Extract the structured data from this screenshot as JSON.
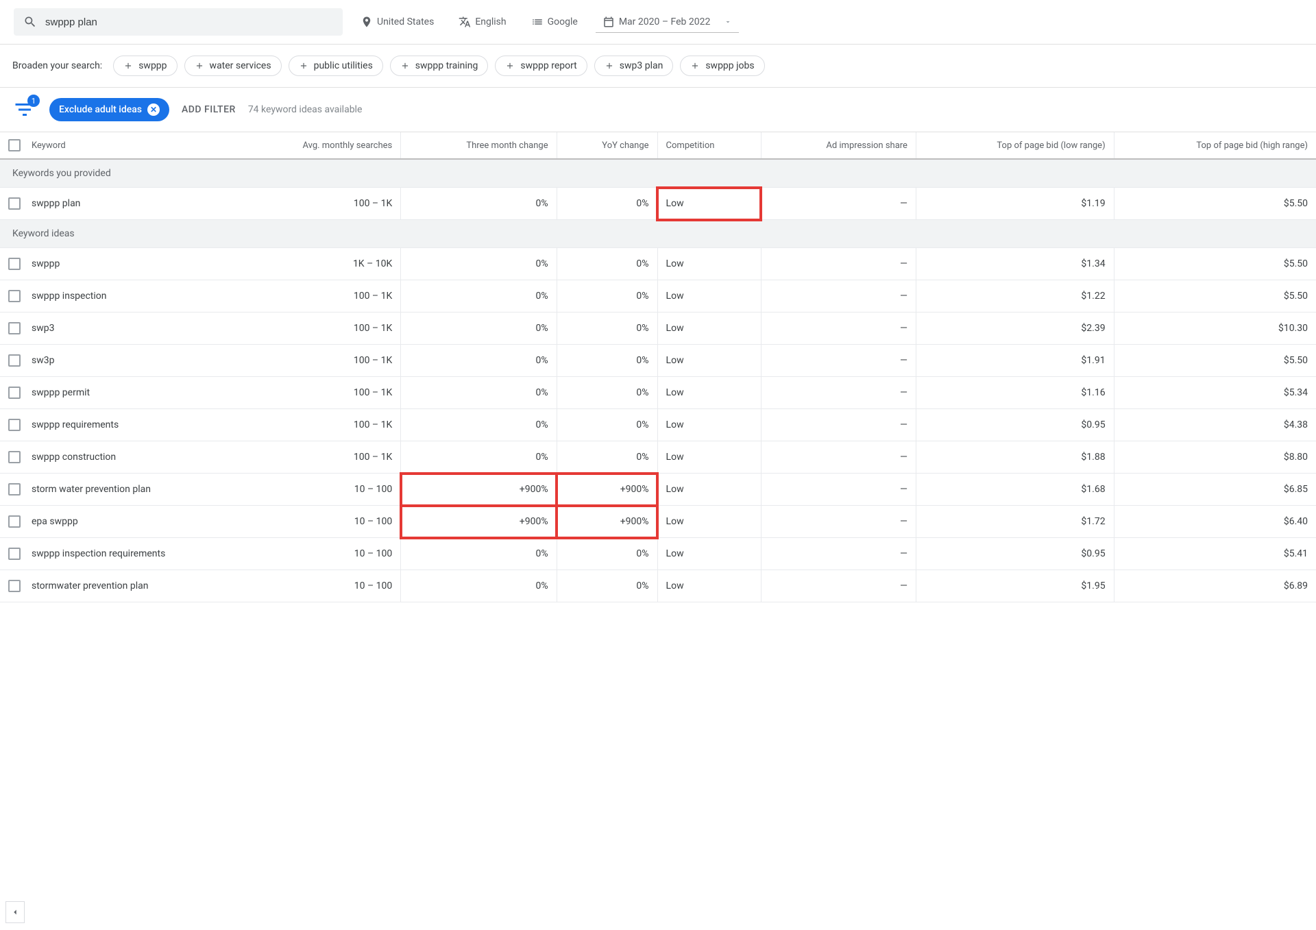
{
  "search": {
    "value": "swppp plan"
  },
  "top_filters": {
    "location": "United States",
    "language": "English",
    "search_network": "Google",
    "date_range": "Mar 2020 – Feb 2022"
  },
  "broaden": {
    "label": "Broaden your search:",
    "chips": [
      "swppp",
      "water services",
      "public utilities",
      "swppp training",
      "swppp report",
      "swp3 plan",
      "swppp jobs"
    ]
  },
  "filters": {
    "funnel_badge": "1",
    "exclude_pill": "Exclude adult ideas",
    "add_filter": "ADD FILTER",
    "count_text": "74 keyword ideas available"
  },
  "columns": {
    "keyword": "Keyword",
    "avg": "Avg. monthly searches",
    "three_month": "Three month change",
    "yoy": "YoY change",
    "competition": "Competition",
    "ad_share": "Ad impression share",
    "bid_low": "Top of page bid (low range)",
    "bid_high": "Top of page bid (high range)"
  },
  "sections": {
    "provided": "Keywords you provided",
    "ideas": "Keyword ideas"
  },
  "rows_provided": [
    {
      "keyword": "swppp plan",
      "avg": "100 – 1K",
      "three_month": "0%",
      "yoy": "0%",
      "competition": "Low",
      "ad_share": "—",
      "bid_low": "$1.19",
      "bid_high": "$5.50",
      "hl_comp": true
    }
  ],
  "rows_ideas": [
    {
      "keyword": "swppp",
      "avg": "1K – 10K",
      "three_month": "0%",
      "yoy": "0%",
      "competition": "Low",
      "ad_share": "—",
      "bid_low": "$1.34",
      "bid_high": "$5.50"
    },
    {
      "keyword": "swppp inspection",
      "avg": "100 – 1K",
      "three_month": "0%",
      "yoy": "0%",
      "competition": "Low",
      "ad_share": "—",
      "bid_low": "$1.22",
      "bid_high": "$5.50"
    },
    {
      "keyword": "swp3",
      "avg": "100 – 1K",
      "three_month": "0%",
      "yoy": "0%",
      "competition": "Low",
      "ad_share": "—",
      "bid_low": "$2.39",
      "bid_high": "$10.30"
    },
    {
      "keyword": "sw3p",
      "avg": "100 – 1K",
      "three_month": "0%",
      "yoy": "0%",
      "competition": "Low",
      "ad_share": "—",
      "bid_low": "$1.91",
      "bid_high": "$5.50"
    },
    {
      "keyword": "swppp permit",
      "avg": "100 – 1K",
      "three_month": "0%",
      "yoy": "0%",
      "competition": "Low",
      "ad_share": "—",
      "bid_low": "$1.16",
      "bid_high": "$5.34"
    },
    {
      "keyword": "swppp requirements",
      "avg": "100 – 1K",
      "three_month": "0%",
      "yoy": "0%",
      "competition": "Low",
      "ad_share": "—",
      "bid_low": "$0.95",
      "bid_high": "$4.38"
    },
    {
      "keyword": "swppp construction",
      "avg": "100 – 1K",
      "three_month": "0%",
      "yoy": "0%",
      "competition": "Low",
      "ad_share": "—",
      "bid_low": "$1.88",
      "bid_high": "$8.80"
    },
    {
      "keyword": "storm water prevention plan",
      "avg": "10 – 100",
      "three_month": "+900%",
      "yoy": "+900%",
      "competition": "Low",
      "ad_share": "—",
      "bid_low": "$1.68",
      "bid_high": "$6.85",
      "hl_change": true
    },
    {
      "keyword": "epa swppp",
      "avg": "10 – 100",
      "three_month": "+900%",
      "yoy": "+900%",
      "competition": "Low",
      "ad_share": "—",
      "bid_low": "$1.72",
      "bid_high": "$6.40",
      "hl_change": true
    },
    {
      "keyword": "swppp inspection requirements",
      "avg": "10 – 100",
      "three_month": "0%",
      "yoy": "0%",
      "competition": "Low",
      "ad_share": "—",
      "bid_low": "$0.95",
      "bid_high": "$5.41"
    },
    {
      "keyword": "stormwater prevention plan",
      "avg": "10 – 100",
      "three_month": "0%",
      "yoy": "0%",
      "competition": "Low",
      "ad_share": "—",
      "bid_low": "$1.95",
      "bid_high": "$6.89"
    }
  ]
}
